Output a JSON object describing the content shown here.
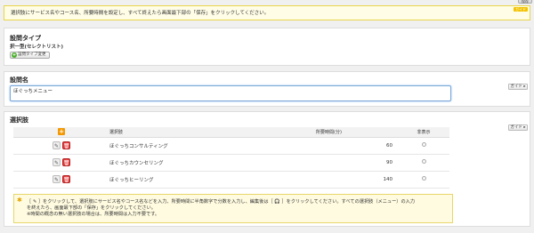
{
  "top_button": "保存",
  "notice": {
    "text": "選択肢にサービス名やコース名、所要時間を設定し、すべて終えたら画面最下部の「保存」をクリックしてください。",
    "tag": "ガイド"
  },
  "question_type": {
    "title": "設問タイプ",
    "value": "択一型(セレクトリスト)",
    "change_button": "設問タイプ変更"
  },
  "question_name": {
    "title": "設問名",
    "value": "ほぐっちメニュー",
    "guide_button": "ガイド ▸"
  },
  "choices": {
    "title": "選択肢",
    "guide_button": "ガイド ▸",
    "headers": {
      "choice": "選択肢",
      "duration": "所要時間(分)",
      "hidden": "非表示"
    },
    "rows": [
      {
        "name": "ほぐっちコンサルティング",
        "duration": "60"
      },
      {
        "name": "ほぐっちカウンセリング",
        "duration": "90"
      },
      {
        "name": "ほぐっちヒーリング",
        "duration": "140"
      }
    ],
    "help_line1": "［ ✎ ］をクリックして、選択肢にサービス名やコース名などを入力、所要時間に半角数字で分数を入力し、編集後は［ 🎧 ］をクリックしてください。すべての選択肢（メニュー）の入力",
    "help_line2": "を終えたら、画面最下部の「保存」をクリックしてください。",
    "help_line3": "※時間の概念の無い選択肢の場合は、所要時間は入力不要です。"
  }
}
